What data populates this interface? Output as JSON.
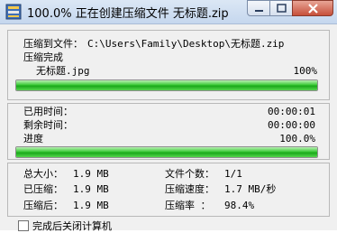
{
  "title": "100.0% 正在创建压缩文件 无标题.zip",
  "compress_to_label": "压缩到文件：",
  "compress_to_path": "C:\\Users\\Family\\Desktop\\无标题.zip",
  "status_text": "压缩完成",
  "current_file": "无标题.jpg",
  "file_percent": "100%",
  "file_progress": 1.0,
  "elapsed_label": "已用时间：",
  "elapsed_value": "00:00:01",
  "remaining_label": "剩余时间：",
  "remaining_value": "00:00:00",
  "progress_label": "进度",
  "progress_value": "100.0%",
  "overall_progress": 1.0,
  "stats": {
    "total_size_label": "总大小：",
    "total_size_value": "1.9 MB",
    "compressed_label": "已压缩：",
    "compressed_value": "1.9 MB",
    "after_label": "压缩后：",
    "after_value": "1.9 MB",
    "file_count_label": "文件个数：",
    "file_count_value": "1/1",
    "speed_label": "压缩速度：",
    "speed_value": "1.7 MB/秒",
    "ratio_label": "压缩率 ：",
    "ratio_value": "98.4%"
  },
  "shutdown_label": "完成后关闭计算机",
  "colors": {
    "progress_green": "#19a81a",
    "close_red": "#c7503a"
  }
}
